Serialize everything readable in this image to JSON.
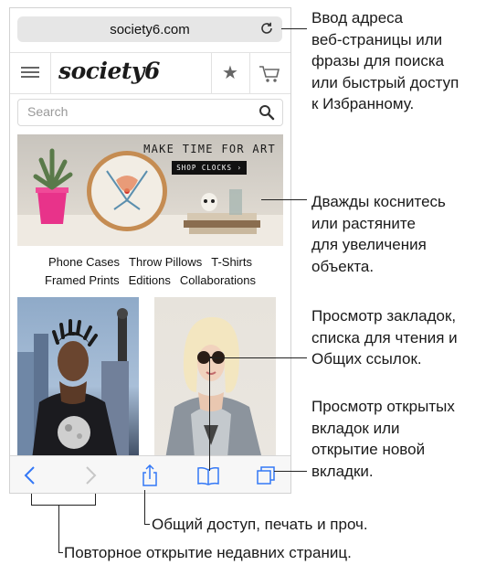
{
  "browser": {
    "url": "society6.com",
    "reload_icon": "reload-icon"
  },
  "site": {
    "logo": "society6",
    "menu_icon": "hamburger-icon",
    "favorite_icon": "star-icon",
    "cart_icon": "cart-icon",
    "search_placeholder": "Search",
    "search_icon": "search-icon"
  },
  "banner": {
    "title": "MAKE TIME FOR ART",
    "cta": "SHOP CLOCKS ›"
  },
  "categories": {
    "row1": [
      "Phone Cases",
      "Throw Pillows",
      "T-Shirts"
    ],
    "row2": [
      "Framed Prints",
      "Editions",
      "Collaborations"
    ]
  },
  "toolbar": {
    "icons": [
      "back-icon",
      "forward-icon",
      "share-icon",
      "bookmarks-icon",
      "tabs-icon"
    ]
  },
  "callouts": {
    "address": [
      "Ввод адреса",
      "веб-страницы или",
      "фразы для поиска",
      "или быстрый доступ",
      "к Избранному."
    ],
    "zoom": [
      "Дважды коснитесь",
      "или растяните",
      "для увеличения",
      "объекта."
    ],
    "bookmarks": [
      "Просмотр закладок,",
      "списка для чтения и",
      "Общих ссылок."
    ],
    "tabs": [
      "Просмотр открытых",
      "вкладок или",
      "открытие новой",
      "вкладки."
    ],
    "share": "Общий доступ, печать и проч.",
    "history": "Повторное открытие недавних страниц."
  },
  "colors": {
    "tint": "#3478f6",
    "toolbar_bg": "#f7f7f7",
    "urlbar_bg": "#e6e6e6"
  }
}
